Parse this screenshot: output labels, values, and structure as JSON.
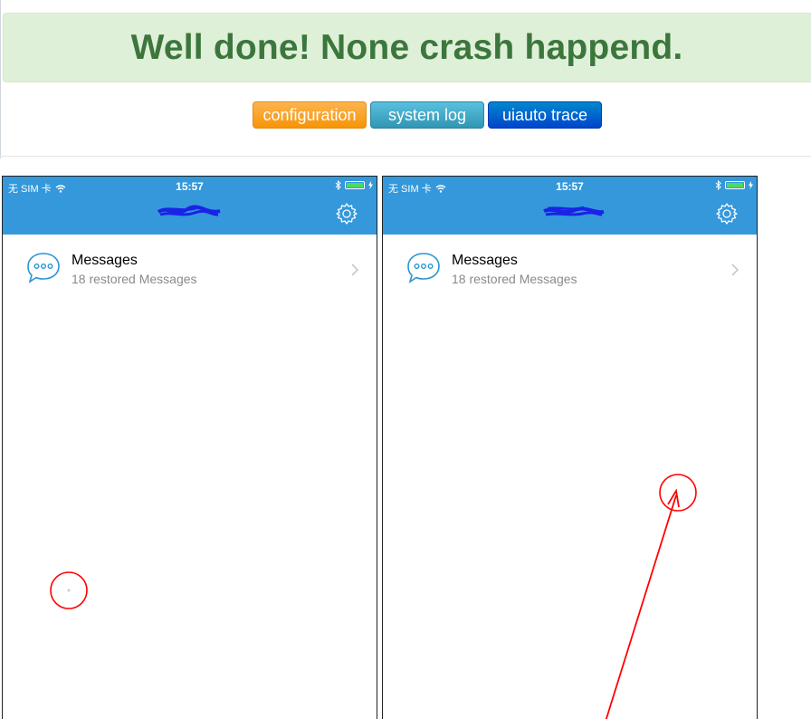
{
  "alert": {
    "title": "Well done! None crash happend."
  },
  "buttons": {
    "configuration": "configuration",
    "system_log": "system log",
    "uiauto_trace": "uiauto trace"
  },
  "colors": {
    "success_bg": "#dff0d8",
    "success_text": "#3c763d",
    "nav_blue": "#3498db",
    "annotation_red": "#ff0000"
  },
  "phones": [
    {
      "status": {
        "carrier": "无 SIM 卡",
        "time": "15:57"
      },
      "cell": {
        "title": "Messages",
        "subtitle": "18 restored Messages"
      }
    },
    {
      "status": {
        "carrier": "无 SIM 卡",
        "time": "15:57"
      },
      "cell": {
        "title": "Messages",
        "subtitle": "18 restored Messages"
      }
    }
  ],
  "icons": [
    "wifi-icon",
    "bluetooth-icon",
    "battery-icon",
    "charging-icon",
    "gear-icon",
    "chat-bubble-icon",
    "chevron-right-icon"
  ]
}
